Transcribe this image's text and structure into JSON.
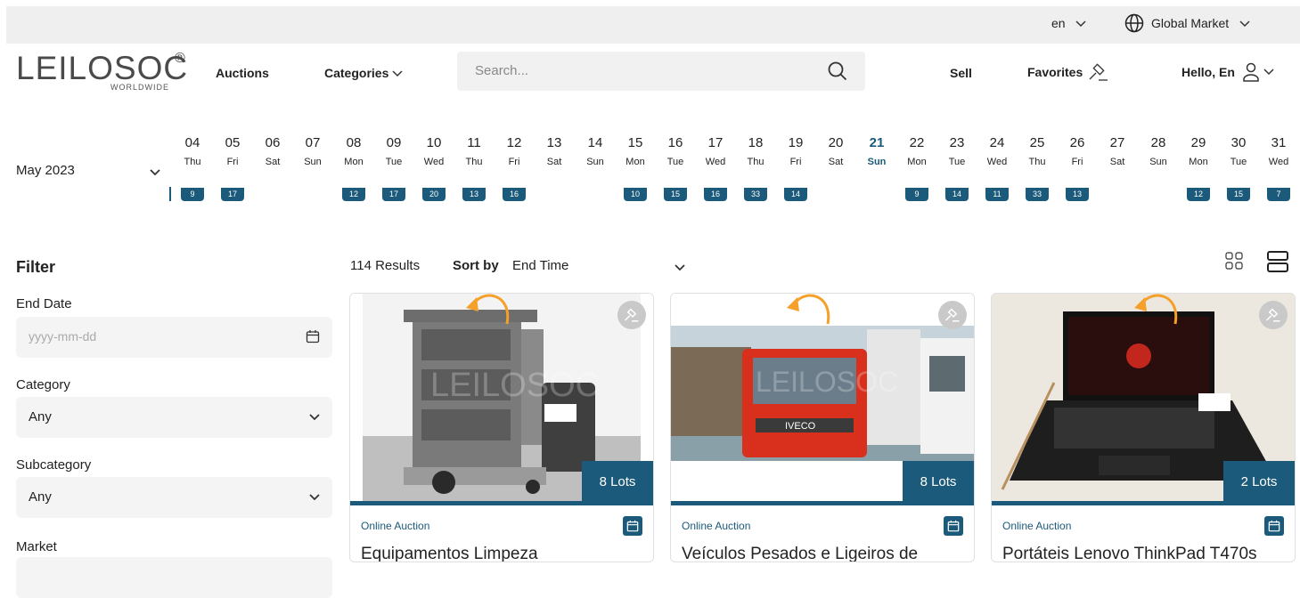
{
  "topbar": {
    "language": "en",
    "market": "Global Market"
  },
  "header": {
    "logo": {
      "brand": "LEILOSOC",
      "reg": "®",
      "sub": "WORLDWIDE"
    },
    "nav_auctions": "Auctions",
    "nav_categories": "Categories",
    "search_placeholder": "Search...",
    "nav_sell": "Sell",
    "nav_favorites": "Favorites",
    "nav_user": "Hello, En"
  },
  "calendar": {
    "month": "May 2023",
    "days": [
      {
        "num": "04",
        "wd": "Thu",
        "count": "9"
      },
      {
        "num": "05",
        "wd": "Fri",
        "count": "17"
      },
      {
        "num": "06",
        "wd": "Sat",
        "count": ""
      },
      {
        "num": "07",
        "wd": "Sun",
        "count": ""
      },
      {
        "num": "08",
        "wd": "Mon",
        "count": "12"
      },
      {
        "num": "09",
        "wd": "Tue",
        "count": "17"
      },
      {
        "num": "10",
        "wd": "Wed",
        "count": "20"
      },
      {
        "num": "11",
        "wd": "Thu",
        "count": "13"
      },
      {
        "num": "12",
        "wd": "Fri",
        "count": "16"
      },
      {
        "num": "13",
        "wd": "Sat",
        "count": ""
      },
      {
        "num": "14",
        "wd": "Sun",
        "count": ""
      },
      {
        "num": "15",
        "wd": "Mon",
        "count": "10"
      },
      {
        "num": "16",
        "wd": "Tue",
        "count": "15"
      },
      {
        "num": "17",
        "wd": "Wed",
        "count": "16"
      },
      {
        "num": "18",
        "wd": "Thu",
        "count": "33"
      },
      {
        "num": "19",
        "wd": "Fri",
        "count": "14"
      },
      {
        "num": "20",
        "wd": "Sat",
        "count": ""
      },
      {
        "num": "21",
        "wd": "Sun",
        "count": "",
        "active": true
      },
      {
        "num": "22",
        "wd": "Mon",
        "count": "9"
      },
      {
        "num": "23",
        "wd": "Tue",
        "count": "14"
      },
      {
        "num": "24",
        "wd": "Wed",
        "count": "11"
      },
      {
        "num": "25",
        "wd": "Thu",
        "count": "33"
      },
      {
        "num": "26",
        "wd": "Fri",
        "count": "13"
      },
      {
        "num": "27",
        "wd": "Sat",
        "count": ""
      },
      {
        "num": "28",
        "wd": "Sun",
        "count": ""
      },
      {
        "num": "29",
        "wd": "Mon",
        "count": "12"
      },
      {
        "num": "30",
        "wd": "Tue",
        "count": "15"
      },
      {
        "num": "31",
        "wd": "Wed",
        "count": "7"
      }
    ]
  },
  "filter": {
    "title": "Filter",
    "end_date_label": "End Date",
    "end_date_placeholder": "yyyy-mm-dd",
    "category_label": "Category",
    "category_value": "Any",
    "subcategory_label": "Subcategory",
    "subcategory_value": "Any",
    "market_label": "Market"
  },
  "results": {
    "count": "114 Results",
    "sort_label": "Sort by",
    "sort_value": "End Time"
  },
  "cards": [
    {
      "lots": "8 Lots",
      "type": "Online Auction",
      "title": "Equipamentos Limpeza"
    },
    {
      "lots": "8 Lots",
      "type": "Online Auction",
      "title": "Veículos Pesados e Ligeiros de"
    },
    {
      "lots": "2 Lots",
      "type": "Online Auction",
      "title": "Portáteis Lenovo ThinkPad T470s"
    }
  ],
  "colors": {
    "accent": "#1b5a7a",
    "arrow": "#f5a02a"
  }
}
